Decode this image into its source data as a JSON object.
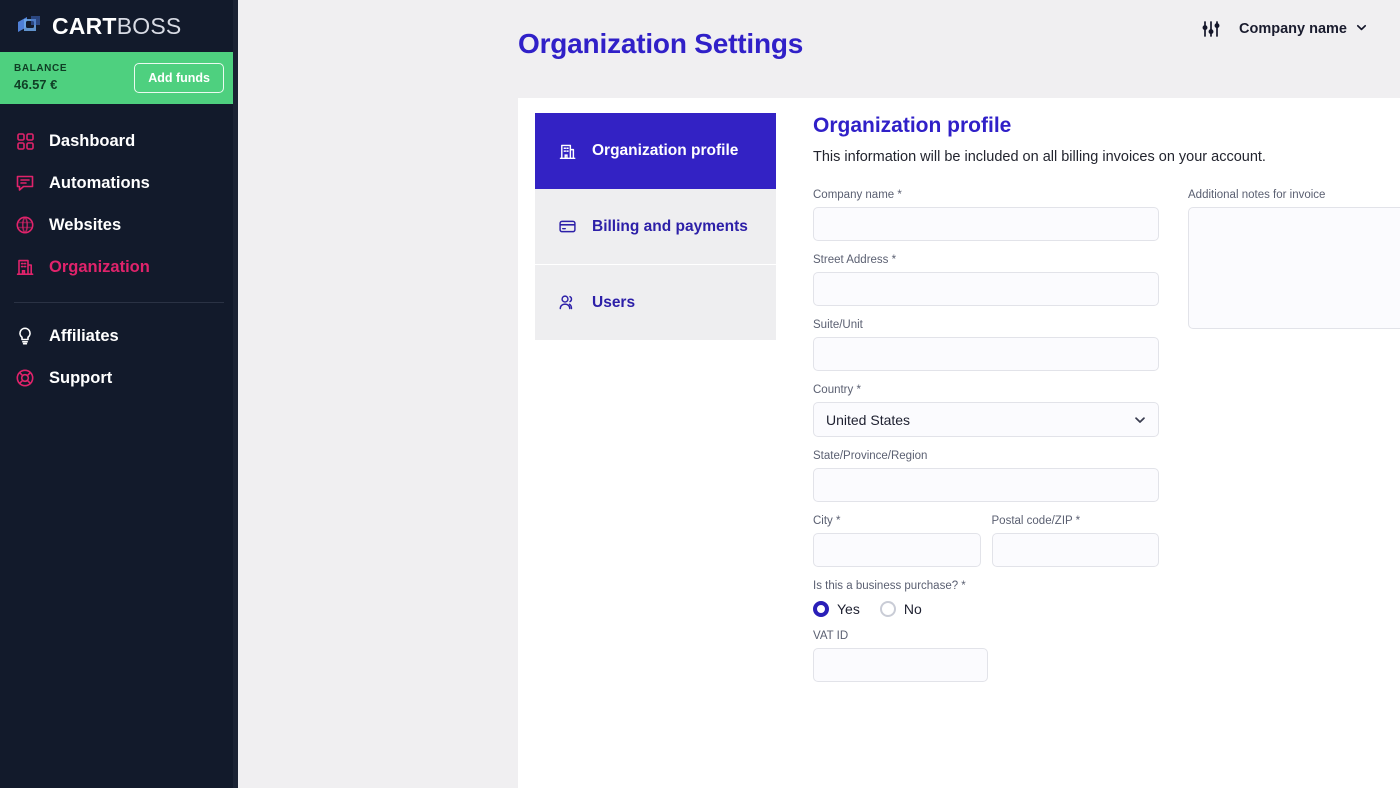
{
  "brand": {
    "logo_text_primary": "CART",
    "logo_text_secondary": "BOSS",
    "logo_icon": "cube-logo-icon",
    "accent_blue": "#3322c4",
    "accent_pink": "#e0236b",
    "sidebar_bg": "#121a2b",
    "balance_green": "#4ed07f"
  },
  "balance": {
    "label": "BALANCE",
    "amount": "46.57 €",
    "add_funds_label": "Add funds"
  },
  "sidebar": {
    "items": [
      {
        "label": "Dashboard",
        "icon": "grid-icon",
        "active": false
      },
      {
        "label": "Automations",
        "icon": "chat-bubble-icon",
        "active": false
      },
      {
        "label": "Websites",
        "icon": "globe-icon",
        "active": false
      },
      {
        "label": "Organization",
        "icon": "building-icon",
        "active": true
      }
    ],
    "secondary_items": [
      {
        "label": "Affiliates",
        "icon": "lightbulb-icon"
      },
      {
        "label": "Support",
        "icon": "lifebuoy-icon"
      }
    ]
  },
  "topbar": {
    "sliders_icon": "sliders-icon",
    "company_label": "Company name",
    "chevron_icon": "chevron-down-icon"
  },
  "page": {
    "title": "Organization Settings"
  },
  "tabs": [
    {
      "label": "Organization profile",
      "icon": "building-icon",
      "active": true
    },
    {
      "label": "Billing and payments",
      "icon": "credit-card-icon",
      "active": false
    },
    {
      "label": "Users",
      "icon": "users-icon",
      "active": false
    }
  ],
  "form": {
    "title": "Organization profile",
    "subtitle": "This information will be included on all billing invoices on your account.",
    "fields": {
      "company_name": {
        "label": "Company name *",
        "value": "",
        "placeholder": ""
      },
      "street_address": {
        "label": "Street Address *",
        "value": "",
        "placeholder": ""
      },
      "suite_unit": {
        "label": "Suite/Unit",
        "value": "",
        "placeholder": ""
      },
      "country": {
        "label": "Country *",
        "value": "United States",
        "options": [
          "United States"
        ]
      },
      "state": {
        "label": "State/Province/Region",
        "value": "",
        "placeholder": ""
      },
      "city": {
        "label": "City *",
        "value": "",
        "placeholder": ""
      },
      "postal_code": {
        "label": "Postal code/ZIP *",
        "value": "",
        "placeholder": ""
      },
      "business_purchase": {
        "label": "Is this a business purchase? *",
        "options": [
          {
            "label": "Yes",
            "selected": true
          },
          {
            "label": "No",
            "selected": false
          }
        ]
      },
      "vat_id": {
        "label": "VAT ID",
        "value": "",
        "placeholder": ""
      },
      "additional_notes": {
        "label": "Additional notes for invoice",
        "value": "",
        "placeholder": ""
      }
    }
  }
}
